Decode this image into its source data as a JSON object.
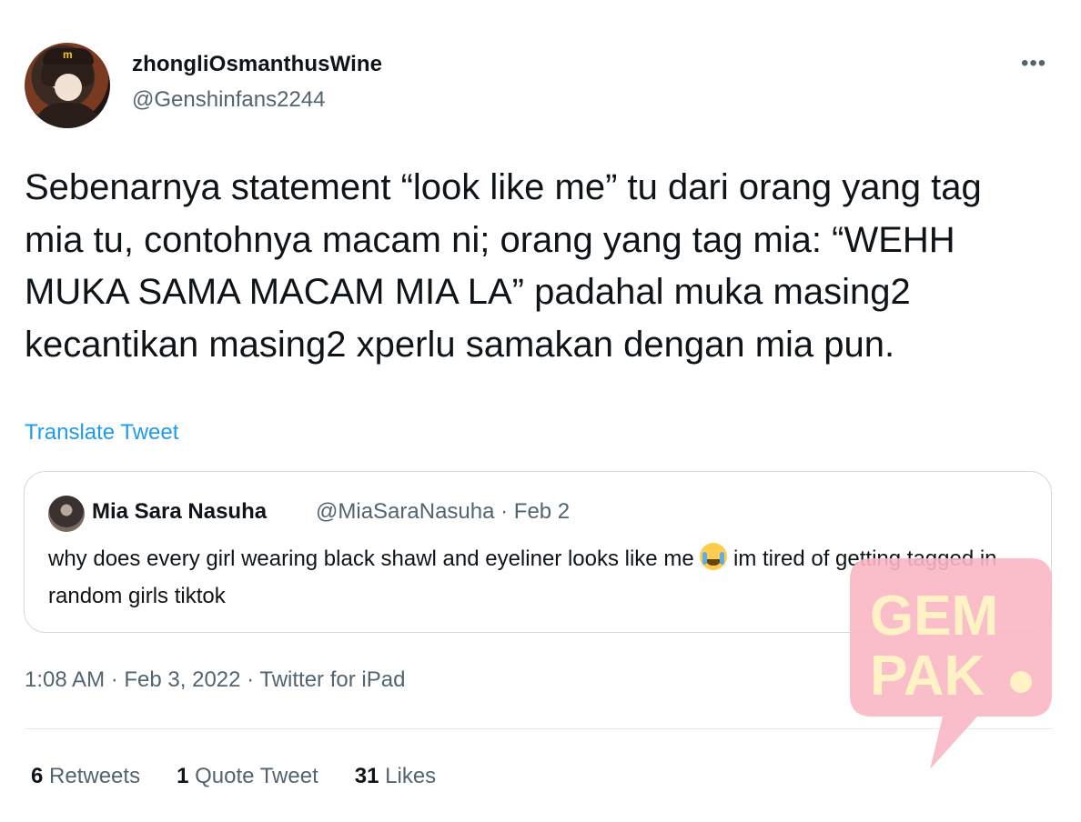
{
  "author": {
    "name": "zhongliOsmanthusWine",
    "handle": "@Genshinfans2244"
  },
  "tweet": {
    "text": "Sebenarnya statement “look like me” tu dari orang yang tag mia tu, contohnya macam ni; orang yang tag mia: “WEHH MUKA SAMA MACAM MIA LA” padahal muka masing2 kecantikan masing2 xperlu samakan dengan mia pun.",
    "translate": "Translate Tweet",
    "meta": "1:08 AM · Feb 3, 2022 · Twitter for iPad"
  },
  "quoted": {
    "name": "Mia Sara Nasuha",
    "meta": "@MiaSaraNasuha · Feb 2",
    "text_before": "why does every girl wearing black shawl and eyeliner looks like me ",
    "text_after": " im tired of getting tagged in random girls tiktok"
  },
  "stats": {
    "retweets_count": "6",
    "retweets_label": "Retweets",
    "quotes_count": "1",
    "quotes_label": "Quote Tweet",
    "likes_count": "31",
    "likes_label": "Likes"
  },
  "watermark": {
    "line1": "GEM",
    "line2": "PAK"
  },
  "colors": {
    "link": "#1d9bf0",
    "secondary": "#536471",
    "watermark": "#f8b7c4"
  }
}
